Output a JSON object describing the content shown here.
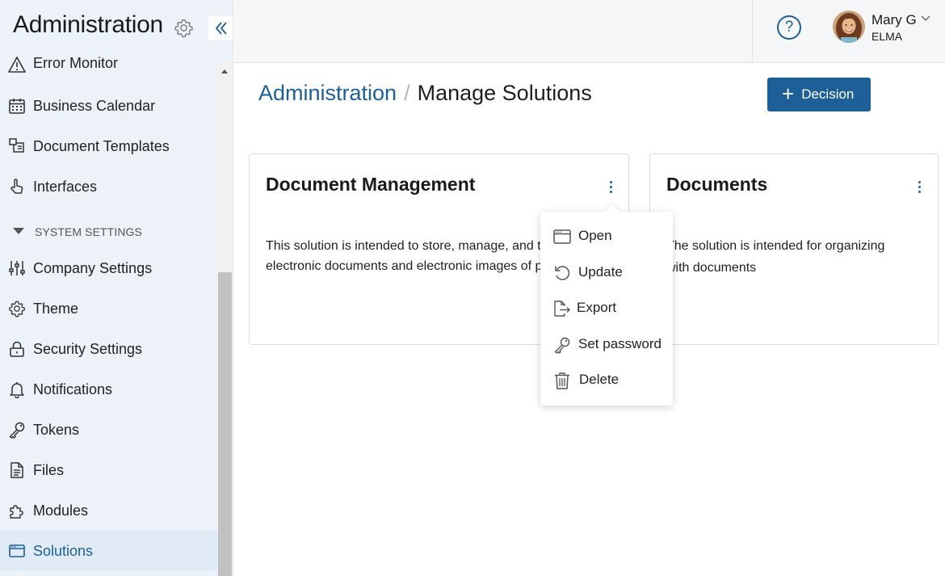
{
  "sidebar": {
    "title": "Administration",
    "items": [
      {
        "label": "Error Monitor",
        "icon": "warning-icon"
      },
      {
        "label": "Business Calendar",
        "icon": "calendar-icon"
      },
      {
        "label": "Document Templates",
        "icon": "document-templates-icon"
      },
      {
        "label": "Interfaces",
        "icon": "pointer-hand-icon"
      },
      {
        "label": "Company Settings",
        "icon": "sliders-icon"
      },
      {
        "label": "Theme",
        "icon": "gear-icon"
      },
      {
        "label": "Security Settings",
        "icon": "lock-icon"
      },
      {
        "label": "Notifications",
        "icon": "bell-icon"
      },
      {
        "label": "Tokens",
        "icon": "key-icon"
      },
      {
        "label": "Files",
        "icon": "file-icon"
      },
      {
        "label": "Modules",
        "icon": "puzzle-icon"
      },
      {
        "label": "Solutions",
        "icon": "window-icon"
      }
    ],
    "section_label": "SYSTEM SETTINGS",
    "active_item": "Solutions"
  },
  "header": {
    "help_label": "?",
    "user": {
      "name": "Mary G",
      "org": "ELMA"
    }
  },
  "main": {
    "breadcrumb": {
      "root": "Administration",
      "separator": "/",
      "current": "Manage Solutions"
    },
    "decision_button": {
      "plus": "+",
      "label": "Decision"
    },
    "cards": [
      {
        "title": "Document Management",
        "description": "This solution is intended to store, manage, and tra\nelectronic documents and electronic images of pa"
      },
      {
        "title": "Documents",
        "description": "The solution is intended for organizing\nwith documents"
      }
    ]
  },
  "context_menu": {
    "items": [
      {
        "label": "Open",
        "icon": "window-icon"
      },
      {
        "label": "Update",
        "icon": "undo-arrow-icon"
      },
      {
        "label": "Export",
        "icon": "export-file-icon"
      },
      {
        "label": "Set password",
        "icon": "key-icon"
      },
      {
        "label": "Delete",
        "icon": "trash-icon"
      }
    ]
  },
  "colors": {
    "accent": "#1d5f97",
    "sidebar_bg": "#edf2f8",
    "active_bg": "#e1ebf5"
  }
}
